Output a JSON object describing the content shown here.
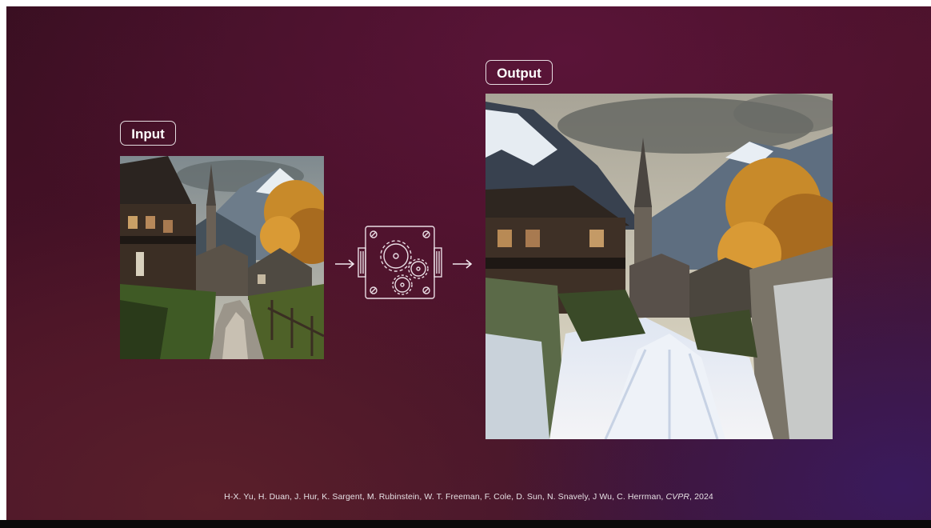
{
  "slide": {
    "input_label": "Input",
    "output_label": "Output",
    "citation": {
      "authors": "H-X. Yu, H. Duan, J. Hur, K. Sargent, M. Rubinstein, W. T. Freeman, F. Cole, D. Sun, N. Snavely, J Wu, C. Herrman,",
      "venue": "CVPR",
      "year": ", 2024"
    }
  },
  "icons": {
    "arrow_left": "arrow-right-icon",
    "model": "gears-machine-icon",
    "arrow_right": "arrow-right-icon"
  },
  "colors": {
    "background": "#4a1228",
    "label_border": "#ffffff",
    "text": "#ffffff"
  }
}
